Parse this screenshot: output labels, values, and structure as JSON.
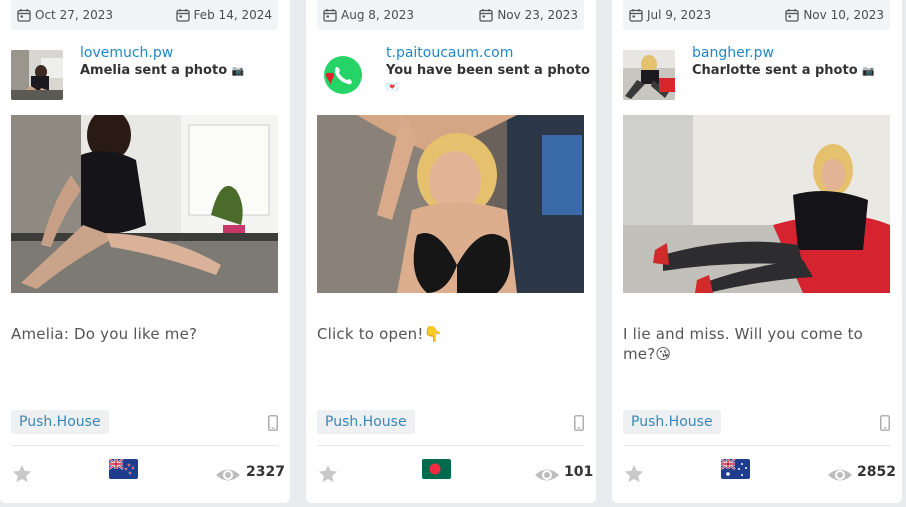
{
  "cards": [
    {
      "start_date": "Oct 27, 2023",
      "end_date": "Feb 14, 2024",
      "site": "lovemuch.pw",
      "message": "Amelia sent a photo",
      "message_emoji": "📷",
      "text": "Amelia: Do you like me?",
      "network": "Push.House",
      "device_icon": "mobile-icon",
      "country_flag": "new-zealand-flag-icon",
      "views": "2327"
    },
    {
      "start_date": "Aug 8, 2023",
      "end_date": "Nov 23, 2023",
      "site": "t.paitoucaum.com",
      "message": "You have been sent a photo",
      "message_emoji": "💌",
      "text": "Click to open!👇",
      "network": "Push.House",
      "device_icon": "mobile-icon",
      "country_flag": "bangladesh-flag-icon",
      "views": "101"
    },
    {
      "start_date": "Jul 9, 2023",
      "end_date": "Nov 10, 2023",
      "site": "bangher.pw",
      "message": "Charlotte sent a photo",
      "message_emoji": "📷",
      "text": "I lie and miss. Will you come to me?😘",
      "network": "Push.House",
      "device_icon": "mobile-icon",
      "country_flag": "australia-flag-icon",
      "views": "2852"
    }
  ]
}
